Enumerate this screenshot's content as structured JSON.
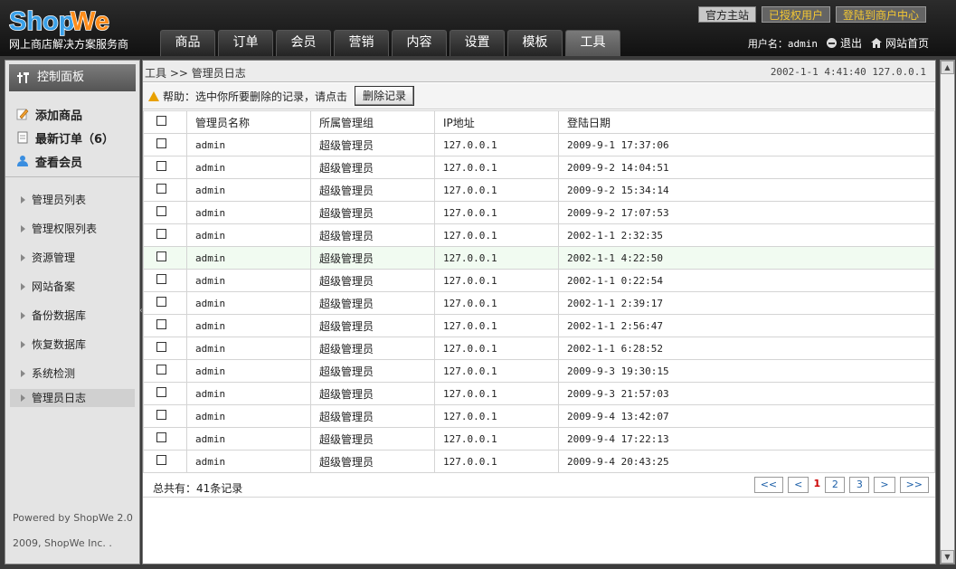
{
  "brand": {
    "logo_text": "ShopWe",
    "slogan": "网上商店解决方案服务商"
  },
  "nav_tabs": [
    "商品",
    "订单",
    "会员",
    "营销",
    "内容",
    "设置",
    "模板",
    "工具"
  ],
  "active_tab": "工具",
  "top_links": {
    "site": "官方主站",
    "licensed": "已授权用户",
    "merchant": "登陆到商户中心"
  },
  "user": {
    "label": "用户名：admin",
    "logout": "退出",
    "home": "网站首页"
  },
  "sidebar": {
    "panel_title": "控制面板",
    "quick": [
      "添加商品",
      "最新订单（6）",
      "查看会员"
    ],
    "items": [
      "管理员列表",
      "管理权限列表",
      "资源管理",
      "网站备案",
      "备份数据库",
      "恢复数据库",
      "系统检测",
      "管理员日志"
    ],
    "active_item": "管理员日志",
    "footer": {
      "powered": "Powered by ShopWe 2.0",
      "copyright": "2009, ShopWe Inc. ."
    }
  },
  "breadcrumb": "工具 >> 管理员日志",
  "timestamp": "2002-1-1 4:41:40 127.0.0.1",
  "help": {
    "text": "帮助：选中你所要删除的记录，请点击",
    "button": "删除记录"
  },
  "table": {
    "headers": [
      "管理员名称",
      "所属管理组",
      "IP地址",
      "登陆日期"
    ],
    "rows": [
      [
        "admin",
        "超级管理员",
        "127.0.0.1",
        "2009-9-1 17:37:06"
      ],
      [
        "admin",
        "超级管理员",
        "127.0.0.1",
        "2009-9-2 14:04:51"
      ],
      [
        "admin",
        "超级管理员",
        "127.0.0.1",
        "2009-9-2 15:34:14"
      ],
      [
        "admin",
        "超级管理员",
        "127.0.0.1",
        "2009-9-2 17:07:53"
      ],
      [
        "admin",
        "超级管理员",
        "127.0.0.1",
        "2002-1-1 2:32:35"
      ],
      [
        "admin",
        "超级管理员",
        "127.0.0.1",
        "2002-1-1 4:22:50"
      ],
      [
        "admin",
        "超级管理员",
        "127.0.0.1",
        "2002-1-1 0:22:54"
      ],
      [
        "admin",
        "超级管理员",
        "127.0.0.1",
        "2002-1-1 2:39:17"
      ],
      [
        "admin",
        "超级管理员",
        "127.0.0.1",
        "2002-1-1 2:56:47"
      ],
      [
        "admin",
        "超级管理员",
        "127.0.0.1",
        "2002-1-1 6:28:52"
      ],
      [
        "admin",
        "超级管理员",
        "127.0.0.1",
        "2009-9-3 19:30:15"
      ],
      [
        "admin",
        "超级管理员",
        "127.0.0.1",
        "2009-9-3 21:57:03"
      ],
      [
        "admin",
        "超级管理员",
        "127.0.0.1",
        "2009-9-4 13:42:07"
      ],
      [
        "admin",
        "超级管理员",
        "127.0.0.1",
        "2009-9-4 17:22:13"
      ],
      [
        "admin",
        "超级管理员",
        "127.0.0.1",
        "2009-9-4 20:43:25"
      ]
    ],
    "highlight_row": 5
  },
  "footer": {
    "total": "总共有：41条记录"
  },
  "pager": {
    "first": "<<",
    "prev": "<",
    "current": "1",
    "pages": [
      "2",
      "3"
    ],
    "next": ">",
    "last": ">>"
  },
  "colors": {
    "accent_yellow": "#f4c832",
    "page_current": "#cc0000",
    "page_link": "#1c5fa8"
  }
}
